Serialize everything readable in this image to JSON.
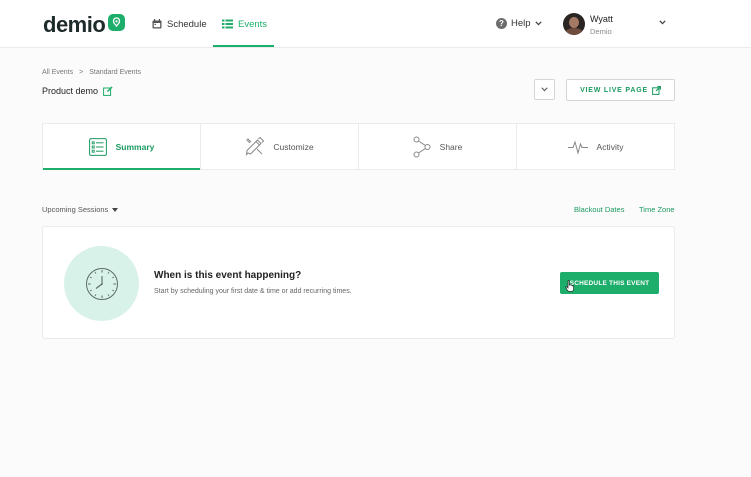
{
  "nav": {
    "logo": "demio",
    "schedule_label": "Schedule",
    "events_label": "Events",
    "help_label": "Help",
    "user_name": "Wyatt",
    "user_org": "Demio"
  },
  "breadcrumb": {
    "root": "All Events",
    "separator": ">",
    "current": "Standard Events"
  },
  "page": {
    "title": "Product demo",
    "view_live_label": "VIEW LIVE PAGE"
  },
  "tabs": [
    {
      "label": "Summary",
      "icon": "list-icon",
      "active": true
    },
    {
      "label": "Customize",
      "icon": "brush-icon",
      "active": false
    },
    {
      "label": "Share",
      "icon": "share-icon",
      "active": false
    },
    {
      "label": "Activity",
      "icon": "pulse-icon",
      "active": false
    }
  ],
  "sessions": {
    "filter_label": "Upcoming Sessions",
    "blackout_label": "Blackout Dates",
    "timezone_label": "Time Zone"
  },
  "empty_state": {
    "title": "When is this event happening?",
    "subtitle": "Start by scheduling your first date & time or add recurring times.",
    "button_label": "SCHEDULE THIS EVENT",
    "icon": "clock-icon"
  },
  "colors": {
    "accent": "#1cae6a",
    "accent_text": "#1a9a5f",
    "clock_bg": "#d9f2e9"
  }
}
